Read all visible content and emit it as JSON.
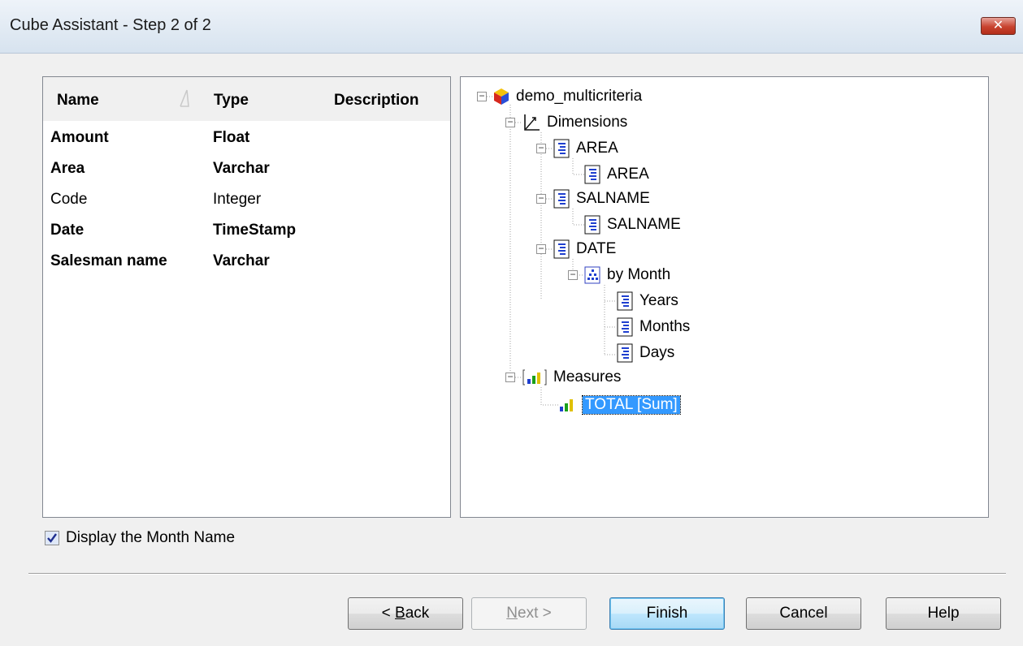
{
  "window": {
    "title": "Cube Assistant - Step 2 of 2",
    "close_label": "✕"
  },
  "fields": {
    "columns": [
      "Name",
      "Type",
      "Description"
    ],
    "rows": [
      {
        "name": "Amount",
        "type": "Float",
        "description": "",
        "bold": true
      },
      {
        "name": "Area",
        "type": "Varchar",
        "description": "",
        "bold": true
      },
      {
        "name": "Code",
        "type": "Integer",
        "description": "",
        "bold": false
      },
      {
        "name": "Date",
        "type": "TimeStamp",
        "description": "",
        "bold": true
      },
      {
        "name": "Salesman name",
        "type": "Varchar",
        "description": "",
        "bold": true
      }
    ]
  },
  "tree": {
    "root": "demo_multicriteria",
    "dimensions": "Dimensions",
    "area": "AREA",
    "area_level": "AREA",
    "salname": "SALNAME",
    "salname_level": "SALNAME",
    "date": "DATE",
    "hierarchy": "by Month",
    "years": "Years",
    "months": "Months",
    "days": "Days",
    "measures": "Measures",
    "total": "TOTAL [Sum]"
  },
  "options": {
    "display_month_name": "Display the Month Name",
    "display_month_name_checked": true
  },
  "buttons": {
    "back": {
      "prefix": "< ",
      "mnemonic": "B",
      "rest": "ack"
    },
    "next": {
      "mnemonic": "N",
      "rest": "ext >"
    },
    "finish": "Finish",
    "cancel": "Cancel",
    "help": "Help"
  },
  "colors": {
    "selection": "#3399ff",
    "tree_icon_blue": "#1f3fcf"
  }
}
